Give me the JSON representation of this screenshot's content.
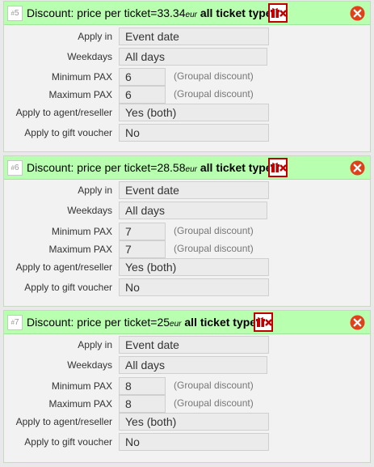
{
  "labels": {
    "apply_in": "Apply in",
    "weekdays": "Weekdays",
    "min_pax": "Minimum PAX",
    "max_pax": "Maximum PAX",
    "agent": "Apply to agent/reseller",
    "gift": "Apply to gift voucher",
    "groupal": "(Groupal discount)"
  },
  "discounts": [
    {
      "number": "5",
      "title_prefix": "Discount: price per ticket=",
      "price": "33.34",
      "currency": "eur",
      "types": "all ticket types,",
      "apply_in": "Event date",
      "weekdays": "All days",
      "min_pax": "6",
      "max_pax": "6",
      "agent": "Yes (both)",
      "gift": "No"
    },
    {
      "number": "6",
      "title_prefix": "Discount: price per ticket=",
      "price": "28.58",
      "currency": "eur",
      "types": "all ticket types,",
      "apply_in": "Event date",
      "weekdays": "All days",
      "min_pax": "7",
      "max_pax": "7",
      "agent": "Yes (both)",
      "gift": "No"
    },
    {
      "number": "7",
      "title_prefix": "Discount: price per ticket=",
      "price": "25",
      "currency": "eur",
      "types": "all ticket types,",
      "apply_in": "Event date",
      "weekdays": "All days",
      "min_pax": "8",
      "max_pax": "8",
      "agent": "Yes (both)",
      "gift": "No"
    }
  ],
  "colors": {
    "header_bg": "#b8ffb0",
    "accent_red": "#c00000",
    "close_red": "#e0401a"
  }
}
